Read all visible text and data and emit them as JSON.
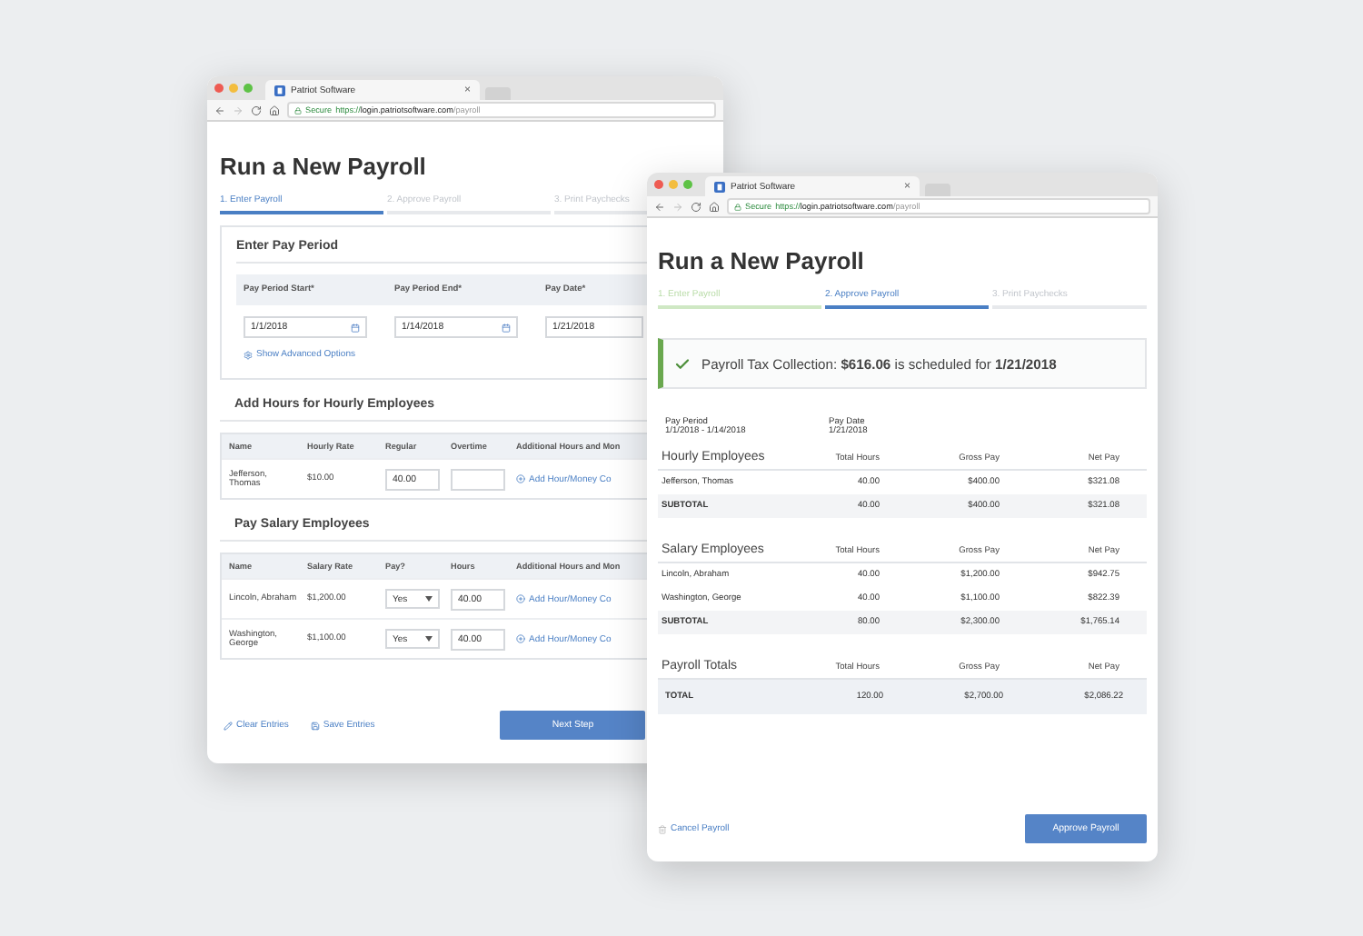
{
  "back_window": {
    "tab_title": "Patriot Software",
    "tab_close": "×",
    "secure_label": "Secure",
    "url": {
      "scheme": "https://",
      "host": "login.patriotsoftware.com",
      "path": "/payroll"
    },
    "heading": "Run a New Payroll",
    "steps": [
      {
        "label": "1. Enter Payroll",
        "selected": true,
        "done": false
      },
      {
        "label": "2. Approve Payroll",
        "selected": false,
        "done": false
      },
      {
        "label": "3. Print Paychecks",
        "selected": false,
        "done": false
      }
    ],
    "pay_period": {
      "title": "Enter Pay Period",
      "fields": [
        {
          "label": "Pay Period Start*",
          "value": "1/1/2018"
        },
        {
          "label": "Pay Period End*",
          "value": "1/14/2018"
        },
        {
          "label": "Pay Date*",
          "value": "1/21/2018"
        }
      ],
      "advanced_link": "Show Advanced Options"
    },
    "hourly": {
      "title": "Add Hours for Hourly Employees",
      "columns": [
        "Name",
        "Hourly Rate",
        "Regular",
        "Overtime",
        "Additional Hours and Mon"
      ],
      "rows": [
        {
          "name": "Jefferson, Thomas",
          "rate": "$10.00",
          "regular": "40.00",
          "link": "Add Hour/Money Co"
        }
      ]
    },
    "salary": {
      "title": "Pay Salary Employees",
      "columns": [
        "Name",
        "Salary Rate",
        "Pay?",
        "Hours",
        "Additional Hours and Mon"
      ],
      "rows": [
        {
          "name": "Lincoln, Abraham",
          "rate": "$1,200.00",
          "pay": "Yes",
          "hours": "40.00",
          "link": "Add Hour/Money Co"
        },
        {
          "name": "Washington, George",
          "rate": "$1,100.00",
          "pay": "Yes",
          "hours": "40.00",
          "link": "Add Hour/Money Co"
        }
      ]
    },
    "footer": {
      "clear": "Clear Entries",
      "save": "Save Entries",
      "next": "Next Step"
    }
  },
  "front_window": {
    "tab_title": "Patriot Software",
    "tab_close": "×",
    "secure_label": "Secure",
    "url": {
      "scheme": "https://",
      "host": "login.patriotsoftware.com",
      "path": "/payroll"
    },
    "heading": "Run a New Payroll",
    "steps": [
      {
        "label": "1. Enter Payroll",
        "selected": false,
        "done": true
      },
      {
        "label": "2. Approve Payroll",
        "selected": true,
        "done": false
      },
      {
        "label": "3. Print Paychecks",
        "selected": false,
        "done": false
      }
    ],
    "alert": "Payroll Tax Collection: **$616.06** is scheduled for **1/21/2018**",
    "summary": [
      {
        "label": "Pay Period",
        "value": "1/1/2018 - 1/14/2018"
      },
      {
        "label": "Pay Date",
        "value": "1/21/2018"
      }
    ],
    "sections": [
      {
        "columns": [
          "Hourly Employees",
          "Total Hours",
          "Gross Pay",
          "Net Pay"
        ],
        "rows": [
          {
            "kind": "employee",
            "cells": [
              "Jefferson, Thomas",
              "40.00",
              "$400.00",
              "$321.08"
            ]
          },
          {
            "kind": "subtotal",
            "cells": [
              "SUBTOTAL",
              "40.00",
              "$400.00",
              "$321.08"
            ]
          }
        ]
      },
      {
        "columns": [
          "Salary Employees",
          "Total Hours",
          "Gross Pay",
          "Net Pay"
        ],
        "rows": [
          {
            "kind": "employee",
            "cells": [
              "Lincoln, Abraham",
              "40.00",
              "$1,200.00",
              "$942.75"
            ]
          },
          {
            "kind": "employee",
            "cells": [
              "Washington, George",
              "40.00",
              "$1,100.00",
              "$822.39"
            ]
          },
          {
            "kind": "subtotal",
            "cells": [
              "SUBTOTAL",
              "80.00",
              "$2,300.00",
              "$1,765.14"
            ]
          }
        ]
      },
      {
        "columns": [
          "Payroll Totals",
          "Total Hours",
          "Gross Pay",
          "Net Pay"
        ],
        "rows": [
          {
            "kind": "total",
            "cells": [
              "TOTAL",
              "120.00",
              "$2,700.00",
              "$2,086.22"
            ]
          }
        ]
      }
    ],
    "footer": {
      "cancel": "Cancel Payroll",
      "approve": "Approve Payroll"
    }
  }
}
